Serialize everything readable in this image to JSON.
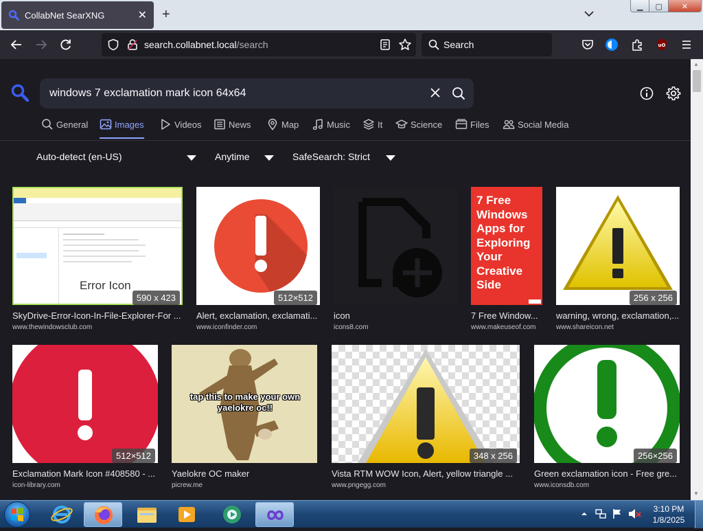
{
  "browser": {
    "tab_title": "CollabNet SearXNG",
    "url_host": "search.collabnet.local",
    "url_path": "/search",
    "search_placeholder": "Search"
  },
  "search": {
    "query": "windows 7 exclamation mark icon 64x64"
  },
  "categories": [
    {
      "label": "General",
      "icon": "search-icon"
    },
    {
      "label": "Images",
      "icon": "image-icon",
      "active": true
    },
    {
      "label": "Videos",
      "icon": "play-icon"
    },
    {
      "label": "News",
      "icon": "newspaper-icon"
    },
    {
      "label": "Map",
      "icon": "map-pin-icon"
    },
    {
      "label": "Music",
      "icon": "music-note-icon"
    },
    {
      "label": "It",
      "icon": "layers-icon"
    },
    {
      "label": "Science",
      "icon": "graduation-cap-icon"
    },
    {
      "label": "Files",
      "icon": "files-icon"
    },
    {
      "label": "Social Media",
      "icon": "people-icon"
    }
  ],
  "filters": {
    "language": "Auto-detect (en-US)",
    "time": "Anytime",
    "safesearch": "SafeSearch: Strict"
  },
  "results": [
    {
      "title": "SkyDrive-Error-Icon-In-File-Explorer-For ...",
      "url": "www.thewindowsclub.com",
      "dims": "590 x 423",
      "overlay": "Error Icon"
    },
    {
      "title": "Alert, exclamation, exclamati...",
      "url": "www.iconfinder.com",
      "dims": "512×512"
    },
    {
      "title": "icon",
      "url": "icons8.com",
      "dims": ""
    },
    {
      "title": "7 Free Window...",
      "url": "www.makeuseof.com",
      "dims": "",
      "overlay": "7 Free Windows Apps for Exploring Your Creative Side"
    },
    {
      "title": "warning, wrong, exclamation,...",
      "url": "www.shareicon.net",
      "dims": "256 x 256"
    },
    {
      "title": "Exclamation Mark Icon #408580 - ...",
      "url": "icon-library.com",
      "dims": "512×512"
    },
    {
      "title": "Yaelokre OC maker",
      "url": "picrew.me",
      "dims": "",
      "overlay": "tap this to make your own yaelokre oc!!"
    },
    {
      "title": "Vista RTM WOW Icon, Alert, yellow triangle ...",
      "url": "www.pngegg.com",
      "dims": "348 x 256"
    },
    {
      "title": "Green exclamation icon - Free gre...",
      "url": "www.iconsdb.com",
      "dims": "256×256"
    }
  ],
  "taskbar": {
    "time": "3:10 PM",
    "date": "1/8/2025"
  },
  "colors": {
    "page_bg": "#1c1b22",
    "accent": "#8fa5ff",
    "query_bg": "#282a36"
  }
}
